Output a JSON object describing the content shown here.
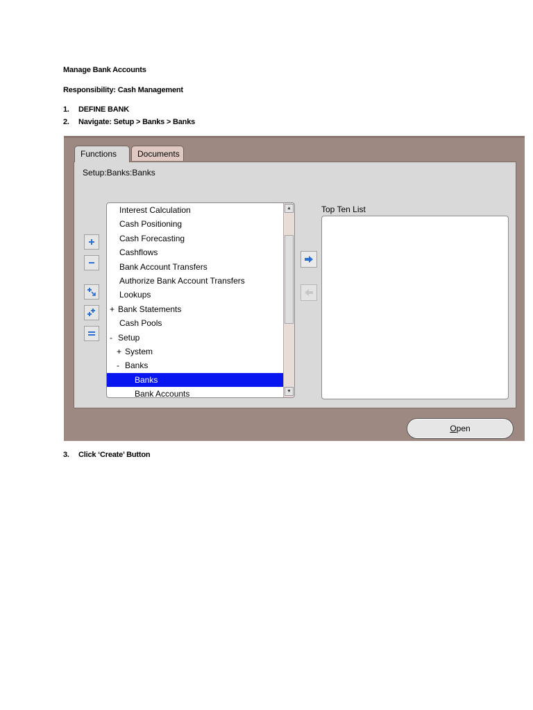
{
  "doc": {
    "title": "Manage Bank Accounts",
    "responsibility": "Responsibility: Cash Management",
    "steps": [
      {
        "num": "1.",
        "text": "DEFINE BANK"
      },
      {
        "num": "2.",
        "text": "Navigate: Setup > Banks > Banks"
      },
      {
        "num": "3.",
        "text": "Click ‘Create’ Button"
      }
    ]
  },
  "window": {
    "tabs": [
      {
        "label": "Functions",
        "active": true
      },
      {
        "label": "Documents",
        "active": false
      }
    ],
    "path": "Setup:Banks:Banks",
    "side_buttons": [
      "expand-icon",
      "collapse-icon",
      "expand-branch-icon",
      "expand-all-icon",
      "collapse-all-icon"
    ],
    "tree": [
      {
        "prefix": "",
        "label": "Interest Calculation"
      },
      {
        "prefix": "",
        "label": "Cash Positioning"
      },
      {
        "prefix": "",
        "label": "Cash Forecasting"
      },
      {
        "prefix": "",
        "label": "Cashflows"
      },
      {
        "prefix": "",
        "label": "Bank Account Transfers"
      },
      {
        "prefix": "",
        "label": "Authorize Bank Account Transfers"
      },
      {
        "prefix": "",
        "label": "Lookups"
      },
      {
        "prefix": "+",
        "label": "Bank Statements"
      },
      {
        "prefix": "",
        "label": "Cash Pools"
      },
      {
        "prefix": "-",
        "label": "Setup"
      },
      {
        "prefix": "+",
        "label": "System"
      },
      {
        "prefix": "-",
        "label": "Banks"
      },
      {
        "prefix": "",
        "label": "Banks",
        "selected": true
      },
      {
        "prefix": "",
        "label": "Bank Accounts"
      }
    ],
    "top_ten_label": "Top Ten List",
    "open_button": {
      "mnemonic": "O",
      "rest": "pen"
    },
    "colors": {
      "selection": "#0a16f0",
      "window_bg": "#9d8882",
      "panel_bg": "#d9d9d9",
      "arrow": "#2a6fd6"
    }
  }
}
